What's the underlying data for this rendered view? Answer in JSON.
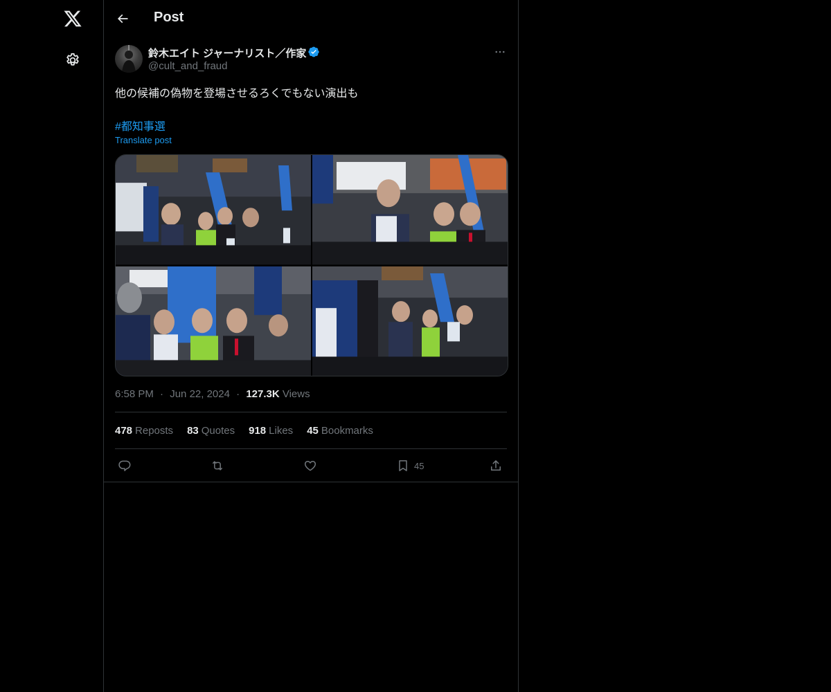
{
  "nav": {
    "logo_icon": "x-logo-icon",
    "settings_icon": "gear-icon"
  },
  "header": {
    "title": "Post",
    "back_icon": "arrow-left-icon"
  },
  "post": {
    "author_name": "鈴木エイト ジャーナリスト／作家",
    "handle": "@cult_and_fraud",
    "verified": true,
    "text": "他の候補の偽物を登場させるろくでもない演出も",
    "hashtag": "#都知事選",
    "translate_label": "Translate post",
    "media_count": 4,
    "time": "6:58 PM",
    "separator": "·",
    "date": "Jun 22, 2024",
    "views_count": "127.3K",
    "views_label": "Views"
  },
  "stats": [
    {
      "count": "478",
      "label": "Reposts"
    },
    {
      "count": "83",
      "label": "Quotes"
    },
    {
      "count": "918",
      "label": "Likes"
    },
    {
      "count": "45",
      "label": "Bookmarks"
    }
  ],
  "actions": {
    "reply_icon": "reply-icon",
    "repost_icon": "repost-icon",
    "like_icon": "heart-icon",
    "bookmark_icon": "bookmark-icon",
    "bookmark_count": "45",
    "share_icon": "share-icon"
  },
  "colors": {
    "background": "#000000",
    "border": "#2f3336",
    "text_primary": "#e7e9ea",
    "text_secondary": "#71767b",
    "accent": "#1d9bf0"
  }
}
